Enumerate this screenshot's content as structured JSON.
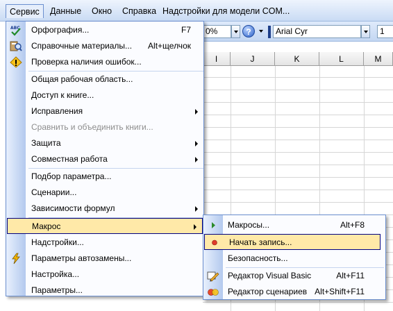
{
  "menubar": {
    "items": [
      {
        "label": "Сервис",
        "active": true
      },
      {
        "label": "Данные"
      },
      {
        "label": "Окно"
      },
      {
        "label": "Справка"
      },
      {
        "label": "Надстройки для модели COM..."
      }
    ]
  },
  "toolbar": {
    "zoom_value": "0%",
    "help_glyph": "?",
    "font_value": "Arial Cyr",
    "size_value": "1"
  },
  "sheet": {
    "columns": [
      "I",
      "J",
      "K",
      "L",
      "M"
    ]
  },
  "service_menu": {
    "items": [
      {
        "label": "Орфография...",
        "shortcut": "F7",
        "icon": "spelling-icon"
      },
      {
        "label": "Справочные материалы...",
        "shortcut": "Alt+щелчок",
        "icon": "research-icon"
      },
      {
        "label": "Проверка наличия ошибок...",
        "icon": "error-check-icon"
      },
      {
        "label": "Общая рабочая область..."
      },
      {
        "label": "Доступ к книге..."
      },
      {
        "label": "Исправления",
        "submenu": true
      },
      {
        "label": "Сравнить и объединить книги...",
        "disabled": true
      },
      {
        "label": "Защита",
        "submenu": true
      },
      {
        "label": "Совместная работа",
        "submenu": true
      },
      {
        "label": "Подбор параметра..."
      },
      {
        "label": "Сценарии..."
      },
      {
        "label": "Зависимости формул",
        "submenu": true
      },
      {
        "label": "Макрос",
        "submenu": true,
        "highlighted": true
      },
      {
        "label": "Надстройки..."
      },
      {
        "label": "Параметры автозамены...",
        "icon": "autocorrect-icon"
      },
      {
        "label": "Настройка..."
      },
      {
        "label": "Параметры..."
      }
    ]
  },
  "macro_submenu": {
    "items": [
      {
        "label": "Макросы...",
        "shortcut": "Alt+F8",
        "icon": "run-macro-icon"
      },
      {
        "label": "Начать запись...",
        "icon": "record-icon",
        "highlighted": true
      },
      {
        "label": "Безопасность..."
      },
      {
        "label": "Редактор Visual Basic",
        "shortcut": "Alt+F11",
        "icon": "vb-editor-icon"
      },
      {
        "label": "Редактор сценариев",
        "shortcut": "Alt+Shift+F11",
        "icon": "script-editor-icon"
      }
    ]
  },
  "colors": {
    "highlight": "#ffe9a8",
    "highlight_border": "#000080",
    "menu_border": "#6b8fcf"
  }
}
